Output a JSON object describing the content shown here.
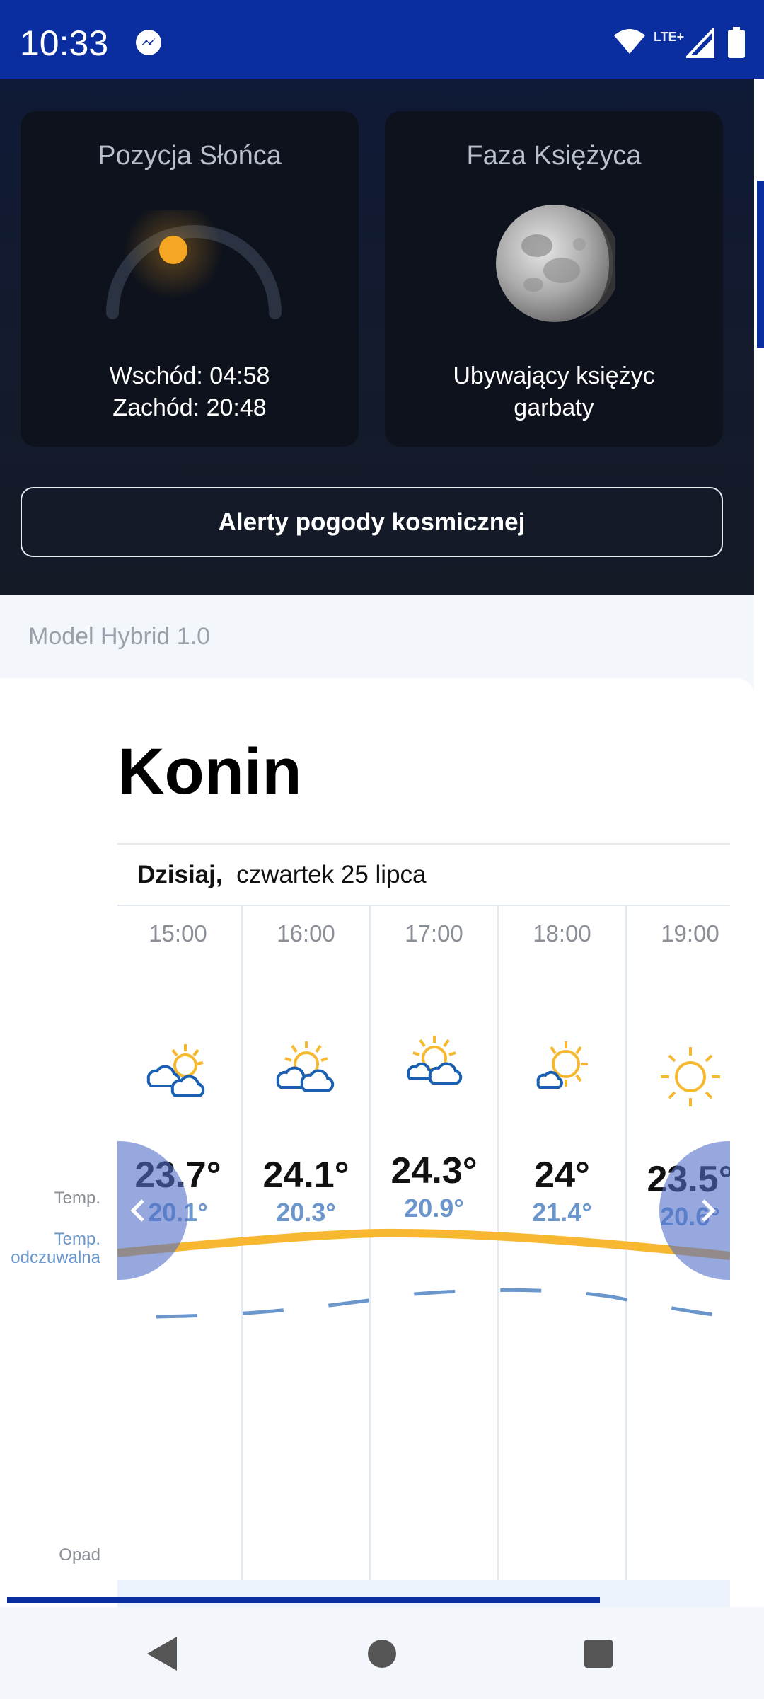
{
  "status_bar": {
    "time": "10:33",
    "network": "LTE+",
    "icons": [
      "messenger-icon",
      "wifi-icon",
      "signal-icon",
      "battery-icon"
    ]
  },
  "sun_card": {
    "title": "Pozycja Słońca",
    "sunrise": "Wschód: 04:58",
    "sunset": "Zachód: 20:48"
  },
  "moon_card": {
    "title": "Faza Księżyca",
    "phase_line1": "Ubywający księżyc",
    "phase_line2": "garbaty"
  },
  "alert_button": "Alerty pogody kosmicznej",
  "model_label": "Model Hybrid 1.0",
  "forecast": {
    "city": "Konin",
    "day_label": "Dzisiaj,",
    "date": "czwartek 25 lipca",
    "row_labels": {
      "temp": "Temp.",
      "feel_line1": "Temp.",
      "feel_line2": "odczuwalna",
      "precip": "Opad"
    },
    "hours": [
      {
        "time": "15:00",
        "temp": "23.7°",
        "feel": "20.1°",
        "icon": "sun-two-clouds-icon"
      },
      {
        "time": "16:00",
        "temp": "24.1°",
        "feel": "20.3°",
        "icon": "sun-two-clouds-icon"
      },
      {
        "time": "17:00",
        "temp": "24.3°",
        "feel": "20.9°",
        "icon": "sun-two-clouds-icon"
      },
      {
        "time": "18:00",
        "temp": "24°",
        "feel": "21.4°",
        "icon": "sun-small-cloud-icon"
      },
      {
        "time": "19:00",
        "temp": "23.5°",
        "feel": "20.6°",
        "icon": "sun-icon"
      }
    ],
    "colors": {
      "temp_line": "#f7b731",
      "feel_line": "#6a96cc",
      "accent": "#0a2ea0"
    }
  }
}
